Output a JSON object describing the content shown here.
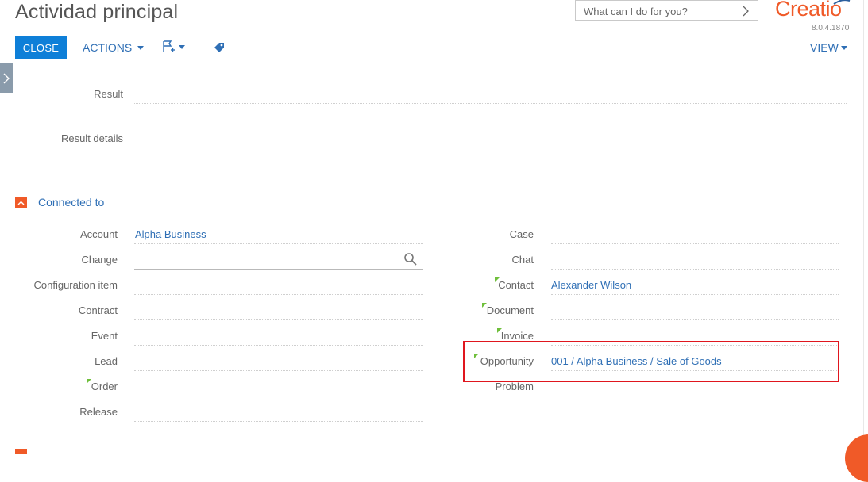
{
  "header": {
    "title": "Actividad principal",
    "search_placeholder": "What can I do for you?",
    "logo_text": "Creatio",
    "version": "8.0.4.1870"
  },
  "toolbar": {
    "close_label": "CLOSE",
    "actions_label": "ACTIONS",
    "view_label": "VIEW",
    "flag_icon": "flag-plus-icon",
    "tag_icon": "tag-icon"
  },
  "fields_top": [
    {
      "label": "Result",
      "value": ""
    },
    {
      "label": "Result details",
      "value": ""
    }
  ],
  "section": {
    "title": "Connected to"
  },
  "left_fields": [
    {
      "label": "Account",
      "value": "Alpha Business",
      "required": false
    },
    {
      "label": "Change",
      "value": "",
      "required": false,
      "search": true
    },
    {
      "label": "Configuration item",
      "value": "",
      "required": false
    },
    {
      "label": "Contract",
      "value": "",
      "required": false
    },
    {
      "label": "Event",
      "value": "",
      "required": false
    },
    {
      "label": "Lead",
      "value": "",
      "required": false
    },
    {
      "label": "Order",
      "value": "",
      "required": true
    },
    {
      "label": "Release",
      "value": "",
      "required": false
    }
  ],
  "right_fields": [
    {
      "label": "Case",
      "value": "",
      "required": false
    },
    {
      "label": "Chat",
      "value": "",
      "required": false
    },
    {
      "label": "Contact",
      "value": "Alexander Wilson",
      "required": true
    },
    {
      "label": "Document",
      "value": "",
      "required": true
    },
    {
      "label": "Invoice",
      "value": "",
      "required": true
    },
    {
      "label": "Opportunity",
      "value": "001 / Alpha Business / Sale of Goods",
      "required": true
    },
    {
      "label": "Problem",
      "value": "",
      "required": false
    }
  ],
  "colors": {
    "accent": "#0e7fd8",
    "link": "#2f6fb5",
    "brand": "#f05a28",
    "highlight": "#e0161e"
  }
}
